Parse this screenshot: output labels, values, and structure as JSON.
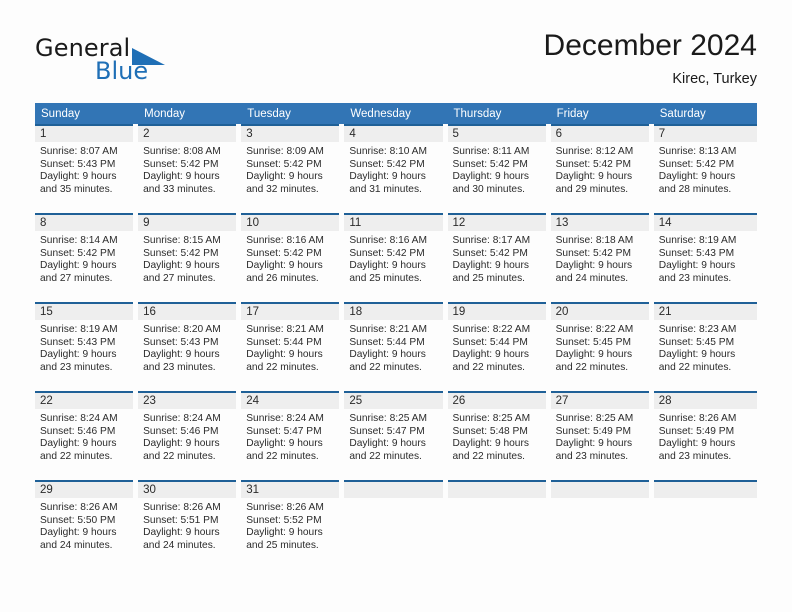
{
  "brand": {
    "name_part1": "General",
    "name_part2": "Blue",
    "triangle_icon": "triangle-icon",
    "accent_color": "#1f6fb6"
  },
  "header": {
    "title": "December 2024",
    "subtitle": "Kirec, Turkey"
  },
  "theme": {
    "header_blue": "#3275b5",
    "cell_top_border": "#1f6097",
    "daynum_bg": "#eeeeee",
    "text": "#2b2b2b"
  },
  "weekdays": [
    "Sunday",
    "Monday",
    "Tuesday",
    "Wednesday",
    "Thursday",
    "Friday",
    "Saturday"
  ],
  "weeks": [
    [
      {
        "day": "1",
        "sunrise": "Sunrise: 8:07 AM",
        "sunset": "Sunset: 5:43 PM",
        "daylight1": "Daylight: 9 hours",
        "daylight2": "and 35 minutes."
      },
      {
        "day": "2",
        "sunrise": "Sunrise: 8:08 AM",
        "sunset": "Sunset: 5:42 PM",
        "daylight1": "Daylight: 9 hours",
        "daylight2": "and 33 minutes."
      },
      {
        "day": "3",
        "sunrise": "Sunrise: 8:09 AM",
        "sunset": "Sunset: 5:42 PM",
        "daylight1": "Daylight: 9 hours",
        "daylight2": "and 32 minutes."
      },
      {
        "day": "4",
        "sunrise": "Sunrise: 8:10 AM",
        "sunset": "Sunset: 5:42 PM",
        "daylight1": "Daylight: 9 hours",
        "daylight2": "and 31 minutes."
      },
      {
        "day": "5",
        "sunrise": "Sunrise: 8:11 AM",
        "sunset": "Sunset: 5:42 PM",
        "daylight1": "Daylight: 9 hours",
        "daylight2": "and 30 minutes."
      },
      {
        "day": "6",
        "sunrise": "Sunrise: 8:12 AM",
        "sunset": "Sunset: 5:42 PM",
        "daylight1": "Daylight: 9 hours",
        "daylight2": "and 29 minutes."
      },
      {
        "day": "7",
        "sunrise": "Sunrise: 8:13 AM",
        "sunset": "Sunset: 5:42 PM",
        "daylight1": "Daylight: 9 hours",
        "daylight2": "and 28 minutes."
      }
    ],
    [
      {
        "day": "8",
        "sunrise": "Sunrise: 8:14 AM",
        "sunset": "Sunset: 5:42 PM",
        "daylight1": "Daylight: 9 hours",
        "daylight2": "and 27 minutes."
      },
      {
        "day": "9",
        "sunrise": "Sunrise: 8:15 AM",
        "sunset": "Sunset: 5:42 PM",
        "daylight1": "Daylight: 9 hours",
        "daylight2": "and 27 minutes."
      },
      {
        "day": "10",
        "sunrise": "Sunrise: 8:16 AM",
        "sunset": "Sunset: 5:42 PM",
        "daylight1": "Daylight: 9 hours",
        "daylight2": "and 26 minutes."
      },
      {
        "day": "11",
        "sunrise": "Sunrise: 8:16 AM",
        "sunset": "Sunset: 5:42 PM",
        "daylight1": "Daylight: 9 hours",
        "daylight2": "and 25 minutes."
      },
      {
        "day": "12",
        "sunrise": "Sunrise: 8:17 AM",
        "sunset": "Sunset: 5:42 PM",
        "daylight1": "Daylight: 9 hours",
        "daylight2": "and 25 minutes."
      },
      {
        "day": "13",
        "sunrise": "Sunrise: 8:18 AM",
        "sunset": "Sunset: 5:42 PM",
        "daylight1": "Daylight: 9 hours",
        "daylight2": "and 24 minutes."
      },
      {
        "day": "14",
        "sunrise": "Sunrise: 8:19 AM",
        "sunset": "Sunset: 5:43 PM",
        "daylight1": "Daylight: 9 hours",
        "daylight2": "and 23 minutes."
      }
    ],
    [
      {
        "day": "15",
        "sunrise": "Sunrise: 8:19 AM",
        "sunset": "Sunset: 5:43 PM",
        "daylight1": "Daylight: 9 hours",
        "daylight2": "and 23 minutes."
      },
      {
        "day": "16",
        "sunrise": "Sunrise: 8:20 AM",
        "sunset": "Sunset: 5:43 PM",
        "daylight1": "Daylight: 9 hours",
        "daylight2": "and 23 minutes."
      },
      {
        "day": "17",
        "sunrise": "Sunrise: 8:21 AM",
        "sunset": "Sunset: 5:44 PM",
        "daylight1": "Daylight: 9 hours",
        "daylight2": "and 22 minutes."
      },
      {
        "day": "18",
        "sunrise": "Sunrise: 8:21 AM",
        "sunset": "Sunset: 5:44 PM",
        "daylight1": "Daylight: 9 hours",
        "daylight2": "and 22 minutes."
      },
      {
        "day": "19",
        "sunrise": "Sunrise: 8:22 AM",
        "sunset": "Sunset: 5:44 PM",
        "daylight1": "Daylight: 9 hours",
        "daylight2": "and 22 minutes."
      },
      {
        "day": "20",
        "sunrise": "Sunrise: 8:22 AM",
        "sunset": "Sunset: 5:45 PM",
        "daylight1": "Daylight: 9 hours",
        "daylight2": "and 22 minutes."
      },
      {
        "day": "21",
        "sunrise": "Sunrise: 8:23 AM",
        "sunset": "Sunset: 5:45 PM",
        "daylight1": "Daylight: 9 hours",
        "daylight2": "and 22 minutes."
      }
    ],
    [
      {
        "day": "22",
        "sunrise": "Sunrise: 8:24 AM",
        "sunset": "Sunset: 5:46 PM",
        "daylight1": "Daylight: 9 hours",
        "daylight2": "and 22 minutes."
      },
      {
        "day": "23",
        "sunrise": "Sunrise: 8:24 AM",
        "sunset": "Sunset: 5:46 PM",
        "daylight1": "Daylight: 9 hours",
        "daylight2": "and 22 minutes."
      },
      {
        "day": "24",
        "sunrise": "Sunrise: 8:24 AM",
        "sunset": "Sunset: 5:47 PM",
        "daylight1": "Daylight: 9 hours",
        "daylight2": "and 22 minutes."
      },
      {
        "day": "25",
        "sunrise": "Sunrise: 8:25 AM",
        "sunset": "Sunset: 5:47 PM",
        "daylight1": "Daylight: 9 hours",
        "daylight2": "and 22 minutes."
      },
      {
        "day": "26",
        "sunrise": "Sunrise: 8:25 AM",
        "sunset": "Sunset: 5:48 PM",
        "daylight1": "Daylight: 9 hours",
        "daylight2": "and 22 minutes."
      },
      {
        "day": "27",
        "sunrise": "Sunrise: 8:25 AM",
        "sunset": "Sunset: 5:49 PM",
        "daylight1": "Daylight: 9 hours",
        "daylight2": "and 23 minutes."
      },
      {
        "day": "28",
        "sunrise": "Sunrise: 8:26 AM",
        "sunset": "Sunset: 5:49 PM",
        "daylight1": "Daylight: 9 hours",
        "daylight2": "and 23 minutes."
      }
    ],
    [
      {
        "day": "29",
        "sunrise": "Sunrise: 8:26 AM",
        "sunset": "Sunset: 5:50 PM",
        "daylight1": "Daylight: 9 hours",
        "daylight2": "and 24 minutes."
      },
      {
        "day": "30",
        "sunrise": "Sunrise: 8:26 AM",
        "sunset": "Sunset: 5:51 PM",
        "daylight1": "Daylight: 9 hours",
        "daylight2": "and 24 minutes."
      },
      {
        "day": "31",
        "sunrise": "Sunrise: 8:26 AM",
        "sunset": "Sunset: 5:52 PM",
        "daylight1": "Daylight: 9 hours",
        "daylight2": "and 25 minutes."
      },
      {
        "day": "",
        "sunrise": "",
        "sunset": "",
        "daylight1": "",
        "daylight2": ""
      },
      {
        "day": "",
        "sunrise": "",
        "sunset": "",
        "daylight1": "",
        "daylight2": ""
      },
      {
        "day": "",
        "sunrise": "",
        "sunset": "",
        "daylight1": "",
        "daylight2": ""
      },
      {
        "day": "",
        "sunrise": "",
        "sunset": "",
        "daylight1": "",
        "daylight2": ""
      }
    ]
  ]
}
